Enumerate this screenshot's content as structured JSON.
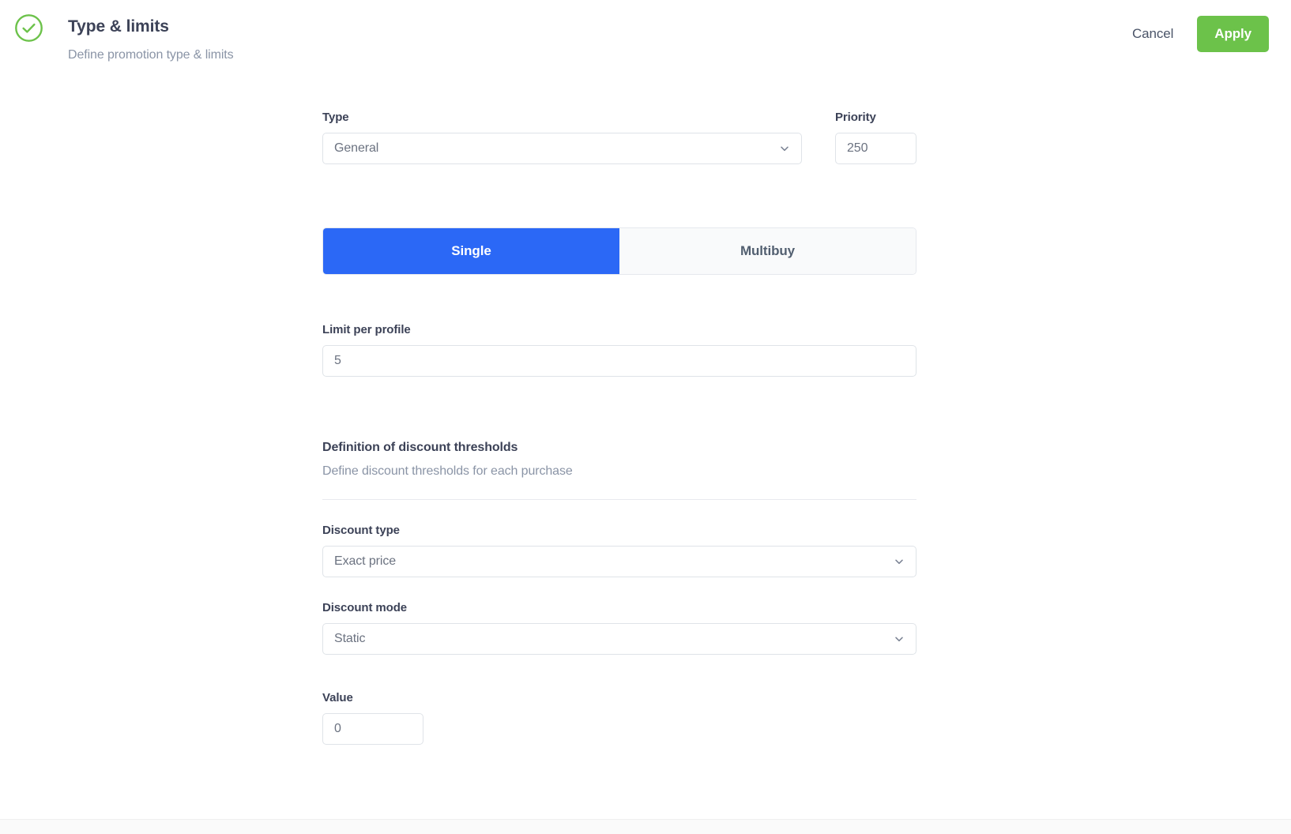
{
  "header": {
    "status_icon": "circle-check-icon",
    "title": "Type & limits",
    "subtitle": "Define promotion type & limits",
    "cancel_label": "Cancel",
    "apply_label": "Apply",
    "accent_green": "#6cc24a"
  },
  "form": {
    "type": {
      "label": "Type",
      "value": "General",
      "icon": "chevron-down-icon"
    },
    "priority": {
      "label": "Priority",
      "value": "250"
    },
    "mode_toggle": {
      "active_color": "#2b68f6",
      "options": [
        {
          "label": "Single",
          "active": true
        },
        {
          "label": "Multibuy",
          "active": false
        }
      ]
    },
    "limit_per_profile": {
      "label": "Limit per profile",
      "value": "5"
    },
    "thresholds_section": {
      "title": "Definition of discount thresholds",
      "subtitle": "Define discount thresholds for each purchase"
    },
    "discount_type": {
      "label": "Discount type",
      "value": "Exact price",
      "icon": "chevron-down-icon"
    },
    "discount_mode": {
      "label": "Discount mode",
      "value": "Static",
      "icon": "chevron-down-icon"
    },
    "value_field": {
      "label": "Value",
      "value": "0"
    }
  }
}
